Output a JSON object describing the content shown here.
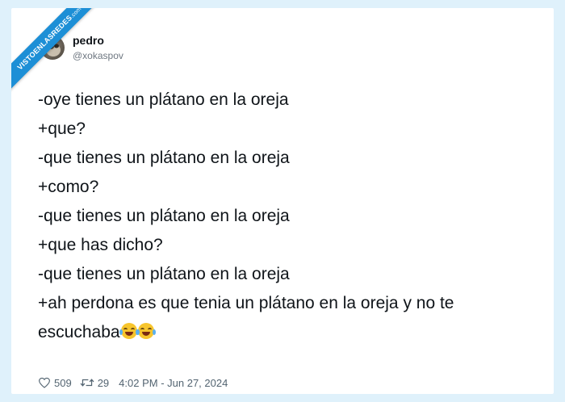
{
  "ribbon": {
    "label": "VISTOENLASREDES",
    "sub": ".com"
  },
  "author": {
    "name": "pedro",
    "handle": "@xokaspov"
  },
  "tweet": {
    "lines": [
      "-oye tienes un plátano en la oreja",
      "+que?",
      "-que tienes un plátano en la oreja",
      "+como?",
      "-que tienes un plátano en la oreja",
      "+que has dicho?",
      "-que tienes un plátano en la oreja",
      "+ah perdona es que tenia un plátano en la oreja y no te",
      "escuchaba"
    ],
    "emoji": "face-with-tears-of-joy"
  },
  "footer": {
    "likes": "509",
    "retweets": "29",
    "timestamp": "4:02 PM - Jun 27, 2024",
    "like_icon": "heart-icon",
    "retweet_icon": "retweet-icon"
  },
  "colors": {
    "background": "#dff1fb",
    "ribbon": "#1d8fd6",
    "text": "#0f1419",
    "muted": "#536471"
  }
}
